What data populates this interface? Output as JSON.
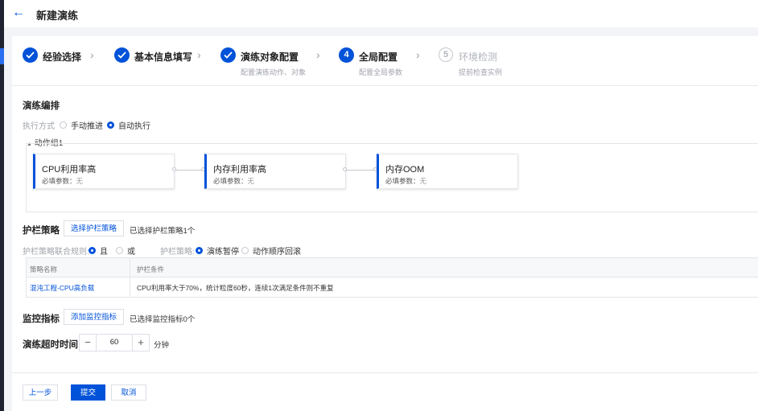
{
  "header": {
    "back_icon": "arrow-left-icon",
    "title": "新建演练"
  },
  "steps": [
    {
      "label": "经验选择",
      "state": "done",
      "sub": ""
    },
    {
      "label": "基本信息填写",
      "state": "done",
      "sub": ""
    },
    {
      "label": "演练对象配置",
      "state": "done",
      "sub": "配置演练动作、对象"
    },
    {
      "label": "全局配置",
      "state": "active",
      "num": "4",
      "sub": "配置全局参数"
    },
    {
      "label": "环境检测",
      "state": "todo",
      "num": "5",
      "sub": "提前检查实例"
    }
  ],
  "orchestration": {
    "section_title": "演练编排",
    "mode_label": "执行方式",
    "modes": [
      "手动推进",
      "自动执行"
    ],
    "selected_mode": "自动执行",
    "group_label": "动作组1",
    "nodes": [
      {
        "title": "CPU利用率高",
        "param_label": "必填参数：",
        "param_value": "无"
      },
      {
        "title": "内存利用率高",
        "param_label": "必填参数：",
        "param_value": "无"
      },
      {
        "title": "内存OOM",
        "param_label": "必填参数：",
        "param_value": "无"
      }
    ]
  },
  "guardrail": {
    "section_title": "护栏策略",
    "select_button": "选择护栏策略",
    "selected_note": "已选择护栏策略1个",
    "combine_label": "护栏策略联合规则:",
    "combine_options": [
      "且",
      "或"
    ],
    "combine_selected": "且",
    "policy_label": "护栏策略:",
    "policy_options": [
      "演练暂停",
      "动作顺序回滚"
    ],
    "policy_selected": "演练暂停",
    "table": {
      "columns": [
        "策略名称",
        "护栏条件"
      ],
      "rows": [
        {
          "name": "混沌工程-CPU高负载",
          "condition": "CPU利用率大于70%，统计粒度60秒，连续1次满足条件则不重复"
        }
      ]
    }
  },
  "monitor": {
    "section_title": "监控指标",
    "add_button": "添加监控指标",
    "selected_note": "已选择监控指标0个"
  },
  "timeout": {
    "label": "演练超时时间",
    "value": "60",
    "unit": "分钟",
    "minus": "−",
    "plus": "+"
  },
  "footer": {
    "prev": "上一步",
    "submit": "提交",
    "cancel": "取消"
  },
  "colors": {
    "accent": "#0052d9",
    "sidebar": "#1f2331"
  }
}
